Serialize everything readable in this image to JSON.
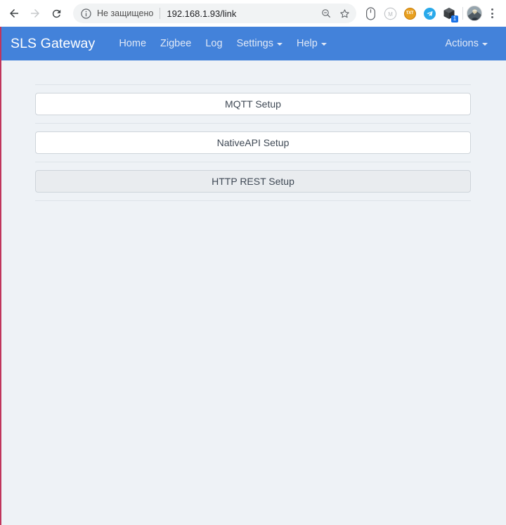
{
  "browser": {
    "back_icon": "arrow-left-icon",
    "forward_icon": "arrow-right-icon",
    "reload_icon": "reload-icon",
    "security_icon": "info-circle-icon",
    "security_label": "Не защищено",
    "url": "192.168.1.93/link",
    "zoom_out_icon": "zoom-out-icon",
    "bookmark_icon": "star-icon",
    "extensions": [
      {
        "name": "mouse-extension-icon",
        "label": ""
      },
      {
        "name": "m-circle-extension-icon",
        "label": "M"
      },
      {
        "name": "txt-extension-icon",
        "label": "TXT"
      },
      {
        "name": "telegram-extension-icon",
        "label": ""
      },
      {
        "name": "cube-extension-icon",
        "label": "",
        "badge": "1"
      }
    ],
    "avatar_name": "profile-avatar",
    "menu_icon": "kebab-menu-icon"
  },
  "navbar": {
    "brand": "SLS Gateway",
    "links": [
      {
        "label": "Home",
        "dropdown": false
      },
      {
        "label": "Zigbee",
        "dropdown": false
      },
      {
        "label": "Log",
        "dropdown": false
      },
      {
        "label": "Settings",
        "dropdown": true
      },
      {
        "label": "Help",
        "dropdown": true
      }
    ],
    "actions": {
      "label": "Actions",
      "dropdown": true
    },
    "background_color": "#4382da",
    "link_color": "#e0e8f6"
  },
  "main": {
    "buttons": [
      {
        "label": "MQTT Setup",
        "style": "light"
      },
      {
        "label": "NativeAPI Setup",
        "style": "light"
      },
      {
        "label": "HTTP REST Setup",
        "style": "secondary"
      }
    ]
  },
  "colors": {
    "page_background": "#eef2f6",
    "accent": "#4382da",
    "left_edge": "#c0355c",
    "button_text": "#3f4955",
    "button_secondary_bg": "#e9ecef",
    "divider": "#dde3e9"
  }
}
